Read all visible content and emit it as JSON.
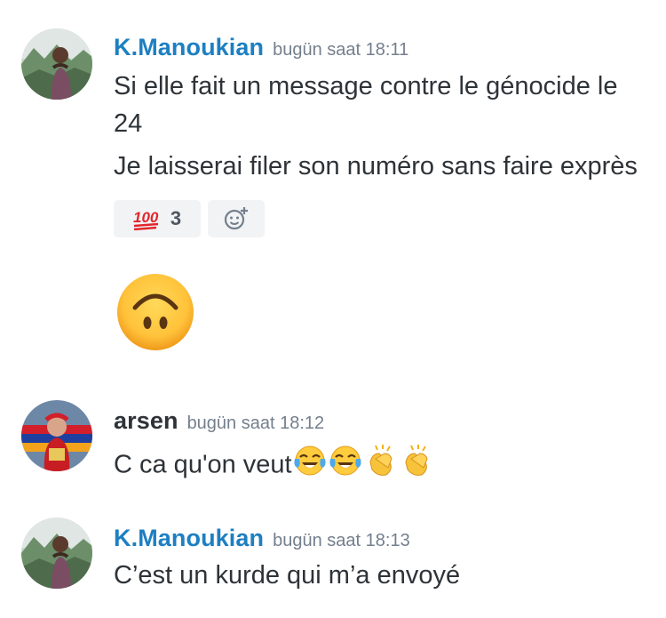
{
  "messages": [
    {
      "username": "K.Manoukian",
      "timestamp": "bugün saat 18:11",
      "lines": [
        "Si elle fait un message contre le génocide le 24",
        "Je laisserai filer son numéro sans faire exprès"
      ],
      "reactions": [
        {
          "emoji": "hundred-points-icon",
          "count": "3"
        }
      ],
      "big_emoji": "upside-down-face-icon"
    },
    {
      "username": "arsen",
      "timestamp": "bugün saat 18:12",
      "text": "C ca qu'on veut",
      "inline_emojis": [
        "tears-of-joy-icon",
        "tears-of-joy-icon",
        "clapping-hands-icon",
        "clapping-hands-icon"
      ]
    },
    {
      "username": "K.Manoukian",
      "timestamp": "bugün saat 18:13",
      "text": "C’est un kurde qui m’a envoyé"
    }
  ],
  "colors": {
    "username_blue": "#1d7fc2",
    "text": "#2e3338",
    "timestamp": "#747f8d",
    "reaction_bg": "#f2f3f5"
  }
}
